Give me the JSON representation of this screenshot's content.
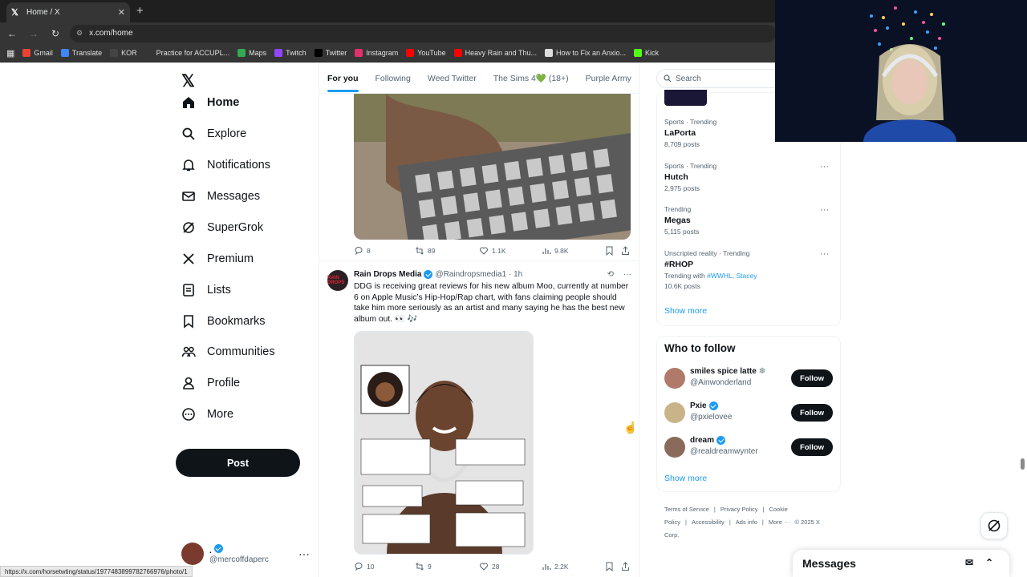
{
  "browser": {
    "tab_title": "Home / X",
    "url": "x.com/home",
    "bookmarks": [
      {
        "label": "Gmail",
        "color": "#ea4335"
      },
      {
        "label": "Translate",
        "color": "#4285f4"
      },
      {
        "label": "KOR",
        "color": "#444444"
      },
      {
        "label": "Practice for ACCUPL...",
        "color": "#353535"
      },
      {
        "label": "Maps",
        "color": "#34a853"
      },
      {
        "label": "Twitch",
        "color": "#9146ff"
      },
      {
        "label": "Twitter",
        "color": "#000000"
      },
      {
        "label": "Instagram",
        "color": "#e1306c"
      },
      {
        "label": "YouTube",
        "color": "#ff0000"
      },
      {
        "label": "Heavy Rain and Thu...",
        "color": "#ff0000"
      },
      {
        "label": "How to Fix an Anxio...",
        "color": "#dddddd"
      },
      {
        "label": "Kick",
        "color": "#53fc18"
      }
    ],
    "status_url": "https://x.com/horsetwting/status/1977483899782766976/photo/1"
  },
  "nav": {
    "items": [
      {
        "label": "Home",
        "icon": "home-icon"
      },
      {
        "label": "Explore",
        "icon": "search-icon"
      },
      {
        "label": "Notifications",
        "icon": "bell-icon"
      },
      {
        "label": "Messages",
        "icon": "envelope-icon"
      },
      {
        "label": "SuperGrok",
        "icon": "grok-icon"
      },
      {
        "label": "Premium",
        "icon": "x-icon"
      },
      {
        "label": "Lists",
        "icon": "list-icon"
      },
      {
        "label": "Bookmarks",
        "icon": "bookmark-icon"
      },
      {
        "label": "Communities",
        "icon": "people-icon"
      },
      {
        "label": "Profile",
        "icon": "person-icon"
      },
      {
        "label": "More",
        "icon": "more-circle-icon"
      }
    ],
    "post_label": "Post",
    "account": {
      "name": ".",
      "handle": "@mercoffdaperc"
    }
  },
  "feed": {
    "tabs": [
      "For you",
      "Following",
      "Weed Twitter",
      "The Sims 4💚 (18+)",
      "Purple Army"
    ],
    "post1_actions": {
      "replies": "8",
      "reposts": "89",
      "likes": "1.1K",
      "views": "9.8K"
    },
    "post2": {
      "name": "Rain Drops Media",
      "handle": "@Raindropsmedia1",
      "time": "· 1h",
      "avatar_text": "RAIN DROPS",
      "text": "DDG is receiving great reviews for his new album Moo, currently at number 6 on Apple Music’s Hip-Hop/Rap chart, with fans claiming people should take him more seriously as an artist and many saying he has the best new album out. 👀 🎶",
      "actions": {
        "replies": "10",
        "reposts": "9",
        "likes": "28",
        "views": "2.2K"
      }
    }
  },
  "sidebar": {
    "search_placeholder": "Search",
    "trends": [
      {
        "context": "Sports · Trending",
        "title": "LaPorta",
        "count": "8,709 posts"
      },
      {
        "context": "Sports · Trending",
        "title": "Hutch",
        "count": "2,975 posts"
      },
      {
        "context": "Trending",
        "title": "Megas",
        "count": "5,115 posts"
      },
      {
        "context": "Unscripted reality · Trending",
        "title": "#RHOP",
        "with_label": "Trending with",
        "with_links": "#WWHL, Stacey",
        "count": "10.6K posts"
      }
    ],
    "show_more": "Show more",
    "who_to_follow": {
      "title": "Who to follow",
      "people": [
        {
          "name": "smiles spice latte",
          "handle": "@Ainwonderland",
          "verified": false,
          "badge": "❄",
          "avatar_color": "#b07a6a"
        },
        {
          "name": "Pxie",
          "handle": "@pxielovee",
          "verified": true,
          "avatar_color": "#c9b48a"
        },
        {
          "name": "dream",
          "handle": "@realdreamwynter",
          "verified": true,
          "avatar_color": "#8a6a5a"
        }
      ],
      "follow_label": "Follow",
      "show_more": "Show more"
    },
    "footer": [
      "Terms of Service",
      "|",
      "Privacy Policy",
      "|",
      "Cookie Policy",
      "|",
      "Accessibility",
      "|",
      "Ads info",
      "|",
      "More ···",
      "© 2025 X Corp."
    ]
  },
  "messages_drawer": {
    "title": "Messages"
  },
  "colors": {
    "accent": "#1d9bf0",
    "text": "#0f1419",
    "muted": "#536471"
  }
}
